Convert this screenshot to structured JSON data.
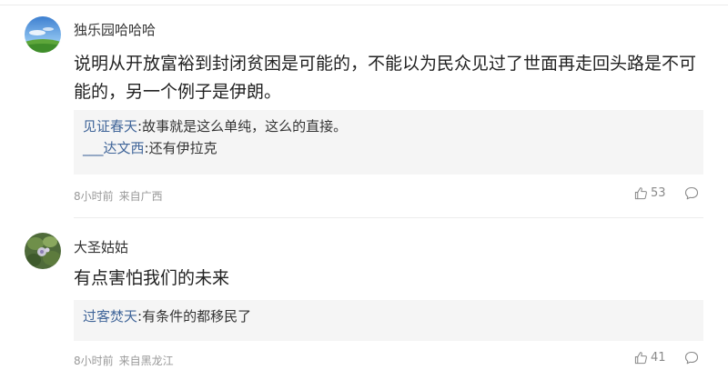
{
  "comments": [
    {
      "username": "独乐园哈哈哈",
      "content": "说明从开放富裕到封闭贫困是可能的，不能以为民众见过了世面再走回头路是不可能的，另一个例子是伊朗。",
      "replies": [
        {
          "name": "见证春天",
          "sep": ":",
          "text": "故事就是这么单纯，这么的直接。"
        },
        {
          "name": "___达文西",
          "sep": ":",
          "text": "还有伊拉克"
        }
      ],
      "time": "8小时前",
      "location": "来自广西",
      "likes": "53"
    },
    {
      "username": "大圣姑姑",
      "content": "有点害怕我们的未来",
      "replies": [
        {
          "name": "过客焚天",
          "sep": ":",
          "text": "有条件的都移民了"
        }
      ],
      "time": "8小时前",
      "location": "来自黑龙江",
      "likes": "41"
    }
  ],
  "icons": {
    "like": "thumbs-up-icon",
    "reply": "speech-bubble-icon"
  },
  "colors": {
    "reply_name": "#406599",
    "meta": "#999999",
    "reply_bg": "#f5f5f5"
  }
}
